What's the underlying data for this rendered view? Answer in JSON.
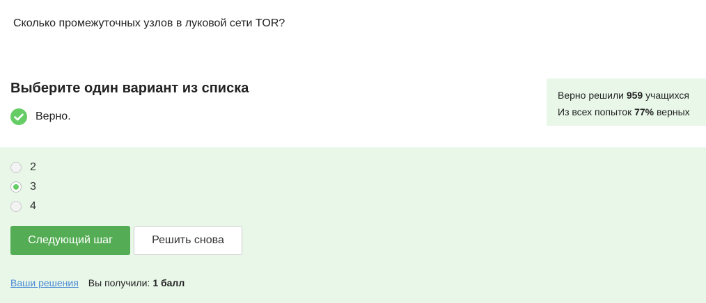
{
  "question": {
    "text": "Сколько промежуточных узлов в луковой сети TOR?"
  },
  "task": {
    "title": "Выберите один вариант из списка"
  },
  "status": {
    "icon": "check-circle-icon",
    "text": "Верно."
  },
  "stats": {
    "line1_prefix": "Верно решили",
    "line1_count": "959",
    "line1_suffix": "учащихся",
    "line2_prefix": "Из всех попыток",
    "line2_percent": "77%",
    "line2_suffix": "верных"
  },
  "options": [
    {
      "label": "2",
      "selected": false
    },
    {
      "label": "3",
      "selected": true
    },
    {
      "label": "4",
      "selected": false
    }
  ],
  "buttons": {
    "next_label": "Следующий шаг",
    "retry_label": "Решить снова"
  },
  "footer": {
    "solutions_link": "Ваши решения",
    "got_label": "Вы получили:",
    "score": "1 балл"
  },
  "colors": {
    "accent": "#54ad54",
    "check": "#66cc66",
    "panel": "#e9f7e9",
    "link": "#4a8ad4"
  }
}
